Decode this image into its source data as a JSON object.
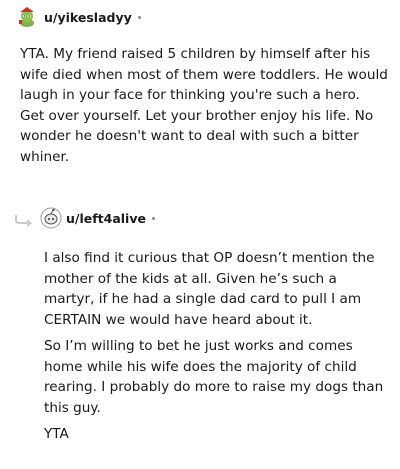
{
  "comment1": {
    "username": "u/yikesladyy",
    "paragraphs": [
      "YTA. My friend raised 5 children by himself after his wife died when most of them were toddlers. He would laugh in your face for thinking you're such a hero. Get over yourself. Let your brother enjoy his life. No wonder he doesn't want to deal with such a bitter whiner."
    ]
  },
  "comment2": {
    "username": "u/left4alive",
    "paragraphs": [
      "I also find it curious that OP doesn’t mention the mother of the kids at all. Given he’s such a martyr, if he had a single dad card to pull I am CERTAIN we would have heard about it.",
      "So I’m willing to bet he just works and comes home while his wife does the majority of child rearing. I probably do more to raise my dogs than this guy.",
      "YTA"
    ]
  },
  "icons": {
    "avatar1": "snoo-avatar-green-red-hat",
    "avatar2": "snoo-avatar-default",
    "reply": "reply-arrow-icon"
  },
  "colors": {
    "text": "#1a1a1b",
    "meta": "#878a8c"
  }
}
